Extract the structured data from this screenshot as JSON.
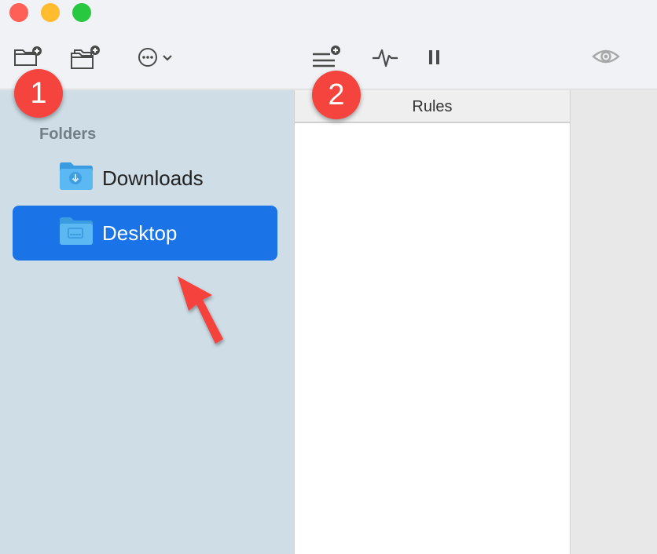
{
  "window": {
    "controls": [
      "close",
      "minimize",
      "zoom"
    ]
  },
  "toolbar": {
    "icons": [
      "new-folder-icon",
      "add-folders-icon",
      "more-options-icon",
      "chevron-down-icon",
      "new-rule-icon",
      "activity-icon",
      "pause-icon",
      "preview-eye-icon"
    ]
  },
  "sidebar": {
    "section_title": "Folders",
    "items": [
      {
        "label": "Downloads",
        "icon": "downloads-folder-icon",
        "selected": false
      },
      {
        "label": "Desktop",
        "icon": "desktop-folder-icon",
        "selected": true
      }
    ]
  },
  "rules_pane": {
    "header": "Rules"
  },
  "annotations": {
    "badge_1": "1",
    "badge_2": "2"
  },
  "colors": {
    "selection": "#1a74e8",
    "sidebar_bg": "#cedde6",
    "badge": "#f5433e",
    "arrow": "#f5433e"
  }
}
